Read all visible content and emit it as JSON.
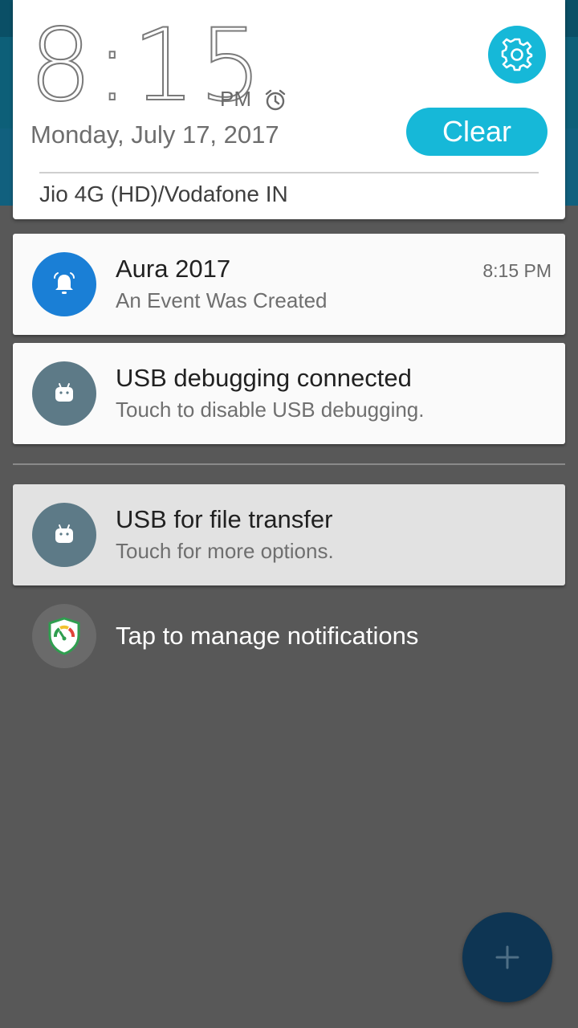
{
  "header": {
    "clock_digits": "8:15",
    "ampm": "PM",
    "date": "Monday, July 17, 2017",
    "clear_label": "Clear",
    "carrier": "Jio 4G (HD)/Vodafone IN",
    "accent_color": "#16b8d8",
    "icons": [
      "alarm-clock-icon",
      "gear-icon"
    ]
  },
  "notifications": [
    {
      "title": "Aura 2017",
      "subtitle": "An Event Was Created",
      "time": "8:15 PM",
      "icon": "bell-icon",
      "icon_color": "#1a7fd6"
    },
    {
      "title": "USB debugging connected",
      "subtitle": "Touch to disable USB debugging.",
      "icon": "android-icon",
      "icon_color": "#5d7a87"
    },
    {
      "title": "USB for file transfer",
      "subtitle": "Touch for more options.",
      "icon": "android-icon",
      "icon_color": "#5d7a87"
    }
  ],
  "manage": {
    "label": "Tap to manage notifications",
    "icon": "shield-gauge-icon"
  },
  "fab": {
    "icon": "plus-icon",
    "color": "#0e3553"
  }
}
